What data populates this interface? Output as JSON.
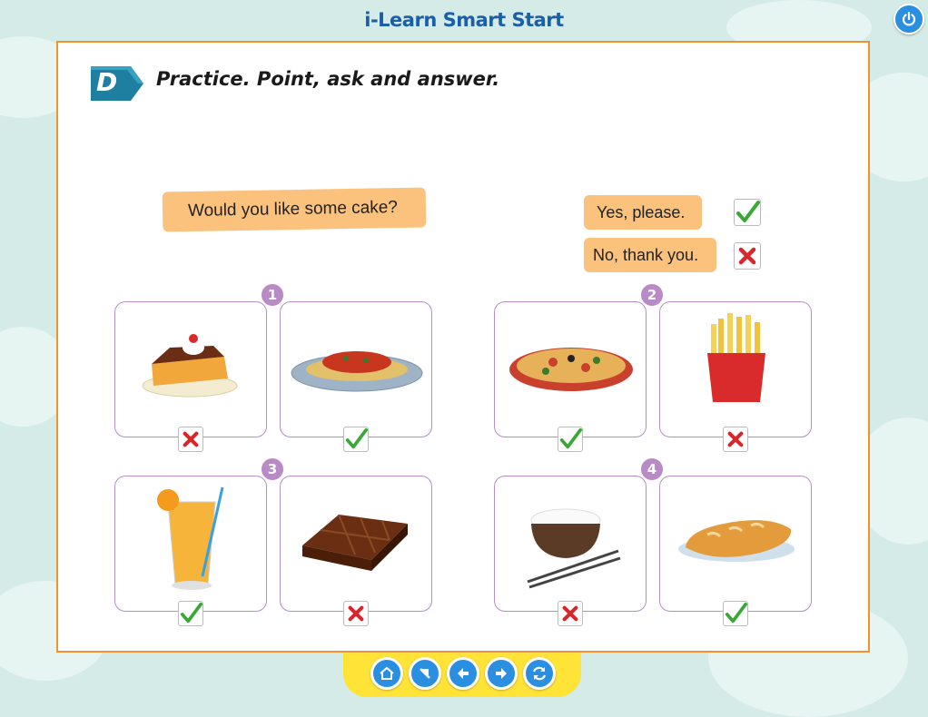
{
  "app": {
    "title": "i-Learn Smart Start"
  },
  "exercise": {
    "section_letter": "D",
    "instruction": "Practice. Point, ask and answer.",
    "question_bubble": "Would you like some cake?",
    "answer_yes": "Yes, please.",
    "answer_no": "No, thank you."
  },
  "groups": [
    {
      "number": "1",
      "items": [
        {
          "food": "cake",
          "mark": "cross"
        },
        {
          "food": "spaghetti",
          "mark": "check"
        }
      ]
    },
    {
      "number": "2",
      "items": [
        {
          "food": "pizza",
          "mark": "check"
        },
        {
          "food": "fries",
          "mark": "cross"
        }
      ]
    },
    {
      "number": "3",
      "items": [
        {
          "food": "orange juice",
          "mark": "check"
        },
        {
          "food": "chocolate",
          "mark": "cross"
        }
      ]
    },
    {
      "number": "4",
      "items": [
        {
          "food": "rice",
          "mark": "cross"
        },
        {
          "food": "bread",
          "mark": "check"
        }
      ]
    }
  ],
  "nav": {
    "buttons": [
      "home-icon",
      "back-to-start-icon",
      "previous-icon",
      "next-icon",
      "refresh-icon"
    ]
  },
  "colors": {
    "border": "#f0922e",
    "bubble": "#fbc27d",
    "card": "#b58fc4",
    "badge": "#1f7fa0",
    "check": "#3aa835",
    "cross": "#d9262b"
  }
}
